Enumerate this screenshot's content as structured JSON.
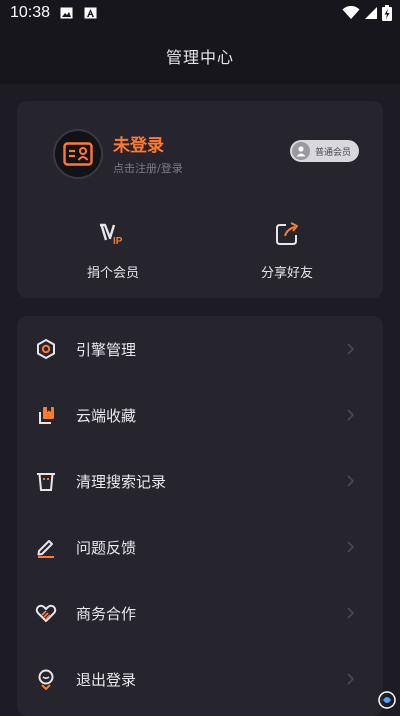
{
  "status_bar": {
    "time": "10:38"
  },
  "header": {
    "title": "管理中心"
  },
  "profile": {
    "status": "未登录",
    "hint": "点击注册/登录",
    "badge": "普通会员"
  },
  "quick_actions": [
    {
      "label": "捐个会员",
      "icon": "vip-icon"
    },
    {
      "label": "分享好友",
      "icon": "share-icon"
    }
  ],
  "menu": [
    {
      "label": "引擎管理",
      "icon": "engine-icon"
    },
    {
      "label": "云端收藏",
      "icon": "cloud-favorites-icon"
    },
    {
      "label": "清理搜索记录",
      "icon": "trash-icon"
    },
    {
      "label": "问题反馈",
      "icon": "feedback-pen-icon"
    },
    {
      "label": "商务合作",
      "icon": "handshake-heart-icon"
    },
    {
      "label": "退出登录",
      "icon": "logout-icon"
    }
  ],
  "colors": {
    "accent": "#ff7a2f",
    "background": "#1d1b24",
    "card": "#26242d"
  }
}
